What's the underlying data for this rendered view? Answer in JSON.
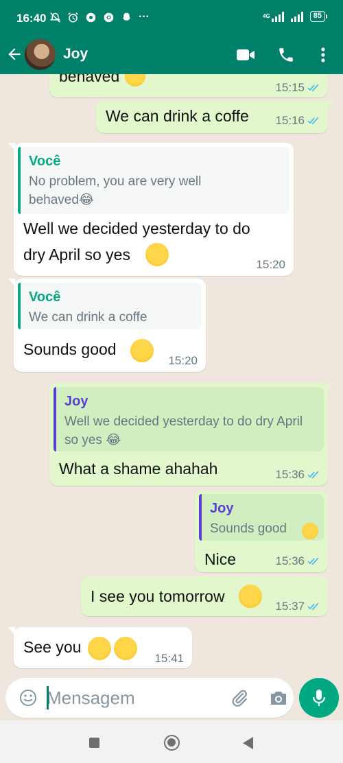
{
  "status_bar": {
    "time": "16:40",
    "battery": "85",
    "network": "4G"
  },
  "header": {
    "contact_name": "Joy"
  },
  "messages": [
    {
      "partial_text": "behaved",
      "time": "15:15"
    },
    {
      "text": "We can drink a coffe",
      "time": "15:16"
    },
    {
      "quote_author": "Você",
      "quote_text": "No problem, you are very well behaved😂",
      "text": "Well we decided yesterday to do",
      "text2": "dry April so yes",
      "time": "15:20"
    },
    {
      "quote_author": "Você",
      "quote_text": "We can drink a coffe",
      "text": "Sounds good",
      "time": "15:20"
    },
    {
      "quote_author": "Joy",
      "quote_text": "Well we decided yesterday to do dry April so yes 😂",
      "text": "What a shame ahahah",
      "time": "15:36"
    },
    {
      "quote_author": "Joy",
      "quote_text": "Sounds good",
      "text": "Nice",
      "time": "15:36"
    },
    {
      "text": "I see you tomorrow",
      "time": "15:37"
    },
    {
      "text": "See you",
      "time": "15:41"
    }
  ],
  "input": {
    "placeholder": "Mensagem"
  },
  "colors": {
    "header": "#008069",
    "outgoing_bubble": "#e2f7cb",
    "incoming_bubble": "#ffffff",
    "chat_background": "#efe7dd",
    "read_ticks": "#53bdeb",
    "quote_self_accent": "#06a884",
    "quote_contact_accent": "#5b3fd1",
    "mic_button": "#00a884"
  }
}
